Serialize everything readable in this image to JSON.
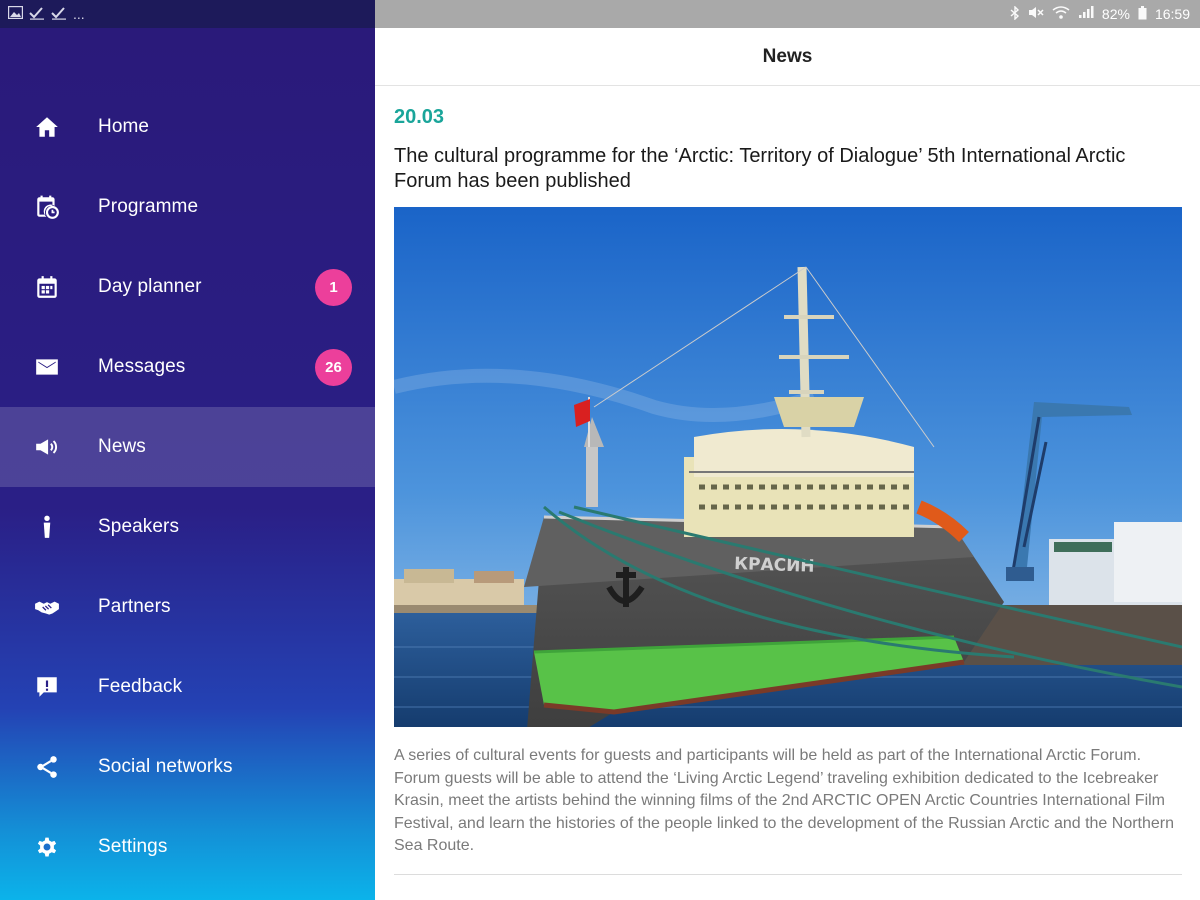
{
  "status_bar": {
    "left_icons": [
      "image-icon",
      "check-icon",
      "check-icon"
    ],
    "left_more": "...",
    "battery_percent": "82%",
    "time": "16:59"
  },
  "sidebar": {
    "items": [
      {
        "label": "Home",
        "icon": "home-icon"
      },
      {
        "label": "Programme",
        "icon": "programme-icon"
      },
      {
        "label": "Day planner",
        "icon": "calendar-icon",
        "badge": "1"
      },
      {
        "label": "Messages",
        "icon": "envelope-icon",
        "badge": "26"
      },
      {
        "label": "News",
        "icon": "megaphone-icon",
        "active": true
      },
      {
        "label": "Speakers",
        "icon": "microphone-icon"
      },
      {
        "label": "Partners",
        "icon": "handshake-icon"
      },
      {
        "label": "Feedback",
        "icon": "feedback-icon"
      },
      {
        "label": "Social networks",
        "icon": "share-icon"
      },
      {
        "label": "Settings",
        "icon": "gear-icon"
      }
    ],
    "colors": {
      "badge": "#ec3f9b",
      "top": "#2a1a7a",
      "bottom": "#0bb3ea"
    }
  },
  "header": {
    "title": "News"
  },
  "news": {
    "date": "20.03",
    "title": "The cultural programme for the ‘Arctic: Territory of Dialogue’ 5th International Arctic Forum has been published",
    "ship_name": "КРАСИН",
    "description": "A series of cultural events for guests and participants will be held as part of the International Arctic Forum. Forum guests will be able to attend the ‘Living Arctic Legend’ traveling exhibition dedicated to the Icebreaker Krasin, meet the artists behind the winning films of the 2nd ARCTIC OPEN Arctic Countries International Film Festival, and learn the histories of the people linked to the development of the Russian Arctic and the Northern Sea Route.",
    "date_color": "#1aa59a"
  }
}
